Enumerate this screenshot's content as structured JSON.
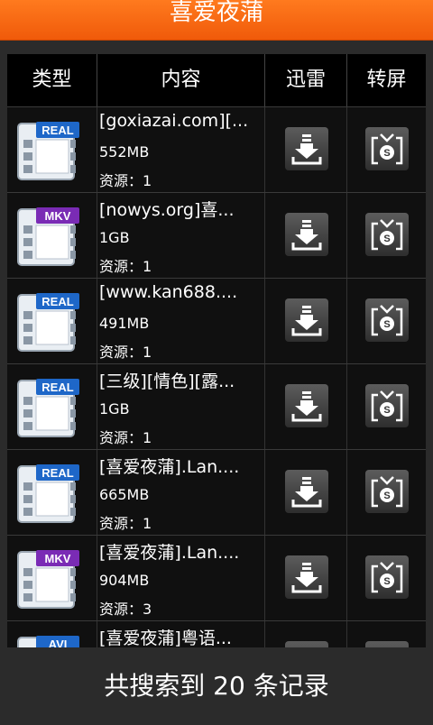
{
  "app": {
    "title": "喜爱夜蒲"
  },
  "table": {
    "headers": [
      "类型",
      "内容",
      "迅雷",
      "转屏"
    ],
    "rows": [
      {
        "type": "REAL",
        "name": "[goxiazai.com][...",
        "size": "552MB",
        "source": "资源：1"
      },
      {
        "type": "MKV",
        "name": "[nowys.org]喜...",
        "size": "1GB",
        "source": "资源：1"
      },
      {
        "type": "REAL",
        "name": "[www.kan688....",
        "size": "491MB",
        "source": "资源：1"
      },
      {
        "type": "REAL",
        "name": "[三级][情色][露...",
        "size": "1GB",
        "source": "资源：1"
      },
      {
        "type": "REAL",
        "name": "[喜爱夜蒲].Lan....",
        "size": "665MB",
        "source": "资源：1"
      },
      {
        "type": "MKV",
        "name": "[喜爱夜蒲].Lan....",
        "size": "904MB",
        "source": "资源：3"
      },
      {
        "type": "AVI",
        "name": "[喜爱夜蒲]粤语...",
        "size": "",
        "source": ""
      }
    ]
  },
  "footer": {
    "text": "共搜索到 20 条记录"
  },
  "colors": {
    "accent": "#f26a10",
    "real_badge": "#1e67c8",
    "mkv_badge": "#7a2bb5",
    "avi_badge": "#1e67c8"
  },
  "icons": {
    "film": "film-strip-icon",
    "download": "download-icon",
    "cast": "cast-screen-icon"
  }
}
